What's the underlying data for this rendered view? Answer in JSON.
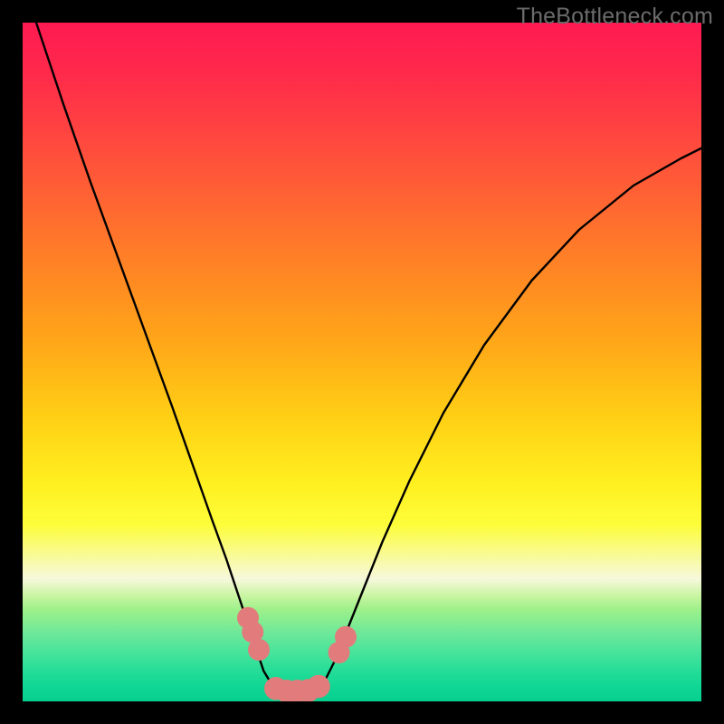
{
  "watermark": "TheBottleneck.com",
  "chart_data": {
    "type": "line",
    "title": "",
    "xlabel": "",
    "ylabel": "",
    "xlim": [
      0,
      100
    ],
    "ylim": [
      0,
      100
    ],
    "grid": false,
    "gradient_stops": [
      {
        "pct": 0,
        "color": "#ff1a52"
      },
      {
        "pct": 8,
        "color": "#ff2b4a"
      },
      {
        "pct": 18,
        "color": "#ff4a3e"
      },
      {
        "pct": 28,
        "color": "#ff6a30"
      },
      {
        "pct": 38,
        "color": "#ff8a22"
      },
      {
        "pct": 48,
        "color": "#ffaa18"
      },
      {
        "pct": 58,
        "color": "#ffcf15"
      },
      {
        "pct": 68,
        "color": "#fff020"
      },
      {
        "pct": 74,
        "color": "#fdfd3a"
      },
      {
        "pct": 79.5,
        "color": "#f8faac"
      },
      {
        "pct": 82,
        "color": "#f6f8dc"
      },
      {
        "pct": 84.5,
        "color": "#c8f5a0"
      },
      {
        "pct": 86.5,
        "color": "#9cf08a"
      },
      {
        "pct": 88,
        "color": "#88ed90"
      },
      {
        "pct": 90,
        "color": "#6de89a"
      },
      {
        "pct": 93,
        "color": "#45e39b"
      },
      {
        "pct": 96,
        "color": "#1fdc97"
      },
      {
        "pct": 98,
        "color": "#0fd694"
      },
      {
        "pct": 100,
        "color": "#07cf8d"
      }
    ],
    "series": [
      {
        "name": "bottleneck-curve",
        "color": "#000000",
        "x_y_pairs": [
          [
            2.0,
            100.0
          ],
          [
            6.0,
            88.0
          ],
          [
            10.0,
            76.5
          ],
          [
            14.0,
            65.5
          ],
          [
            18.0,
            54.5
          ],
          [
            22.0,
            43.5
          ],
          [
            25.0,
            35.0
          ],
          [
            28.0,
            26.5
          ],
          [
            30.0,
            21.0
          ],
          [
            31.5,
            16.5
          ],
          [
            33.0,
            12.0
          ],
          [
            34.0,
            9.0
          ],
          [
            35.5,
            4.5
          ],
          [
            37.0,
            2.0
          ],
          [
            38.5,
            1.5
          ],
          [
            40.0,
            1.5
          ],
          [
            41.5,
            1.5
          ],
          [
            43.0,
            1.8
          ],
          [
            44.5,
            3.0
          ],
          [
            46.0,
            6.0
          ],
          [
            48.0,
            11.0
          ],
          [
            50.0,
            16.0
          ],
          [
            53.0,
            23.5
          ],
          [
            57.0,
            32.5
          ],
          [
            62.0,
            42.5
          ],
          [
            68.0,
            52.5
          ],
          [
            75.0,
            62.0
          ],
          [
            82.0,
            69.5
          ],
          [
            90.0,
            76.0
          ],
          [
            97.0,
            80.0
          ],
          [
            100.0,
            81.5
          ]
        ]
      }
    ],
    "markers": [
      {
        "name": "left-upper-cluster",
        "color": "#e27c7c",
        "cx": 33.2,
        "cy": 12.3,
        "r": 1.6
      },
      {
        "name": "left-upper-cluster",
        "color": "#e27c7c",
        "cx": 33.9,
        "cy": 10.2,
        "r": 1.6
      },
      {
        "name": "left-upper-cluster",
        "color": "#e27c7c",
        "cx": 34.8,
        "cy": 7.6,
        "r": 1.6
      },
      {
        "name": "bottom-cluster",
        "color": "#e27c7c",
        "cx": 37.3,
        "cy": 1.9,
        "r": 1.7
      },
      {
        "name": "bottom-cluster",
        "color": "#e27c7c",
        "cx": 38.9,
        "cy": 1.5,
        "r": 1.7
      },
      {
        "name": "bottom-cluster",
        "color": "#e27c7c",
        "cx": 40.5,
        "cy": 1.5,
        "r": 1.7
      },
      {
        "name": "bottom-cluster",
        "color": "#e27c7c",
        "cx": 42.1,
        "cy": 1.6,
        "r": 1.7
      },
      {
        "name": "bottom-cluster",
        "color": "#e27c7c",
        "cx": 43.6,
        "cy": 2.2,
        "r": 1.7
      },
      {
        "name": "right-upper-cluster",
        "color": "#e27c7c",
        "cx": 46.6,
        "cy": 7.2,
        "r": 1.6
      },
      {
        "name": "right-upper-cluster",
        "color": "#e27c7c",
        "cx": 47.6,
        "cy": 9.5,
        "r": 1.6
      }
    ]
  }
}
